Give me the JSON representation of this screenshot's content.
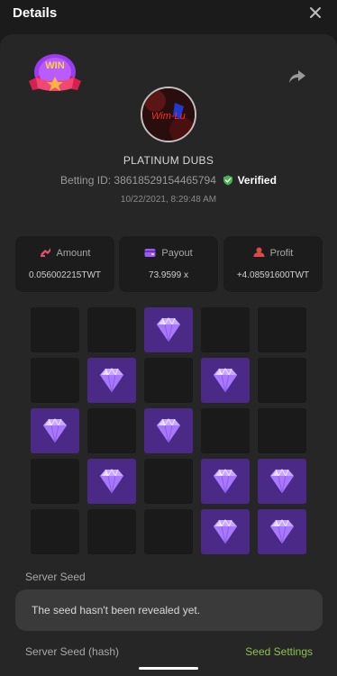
{
  "header": {
    "title": "Details",
    "close_icon": "close-icon"
  },
  "badge": {
    "text": "WIN",
    "icon": "win-ribbon-icon"
  },
  "share_icon": "share-arrow-icon",
  "player": {
    "avatar_text": "Wim-Lu",
    "name": "PLATINUM DUBS",
    "betting_id_label": "Betting ID:",
    "betting_id": "38618529154465794",
    "verified_label": "Verified",
    "date": "10/22/2021, 8:29:48 AM"
  },
  "stats": [
    {
      "label": "Amount",
      "value": "0.056002215TWT",
      "icon": "amount-icon",
      "color": "#e0506a"
    },
    {
      "label": "Payout",
      "value": "73.9599 x",
      "icon": "wallet-icon",
      "color": "#9b5cf0"
    },
    {
      "label": "Profit",
      "value": "+4.08591600TWT",
      "icon": "profit-icon",
      "color": "#e04848"
    }
  ],
  "grid": {
    "rows": 5,
    "cols": 5,
    "cells": [
      [
        0,
        0,
        1,
        0,
        0
      ],
      [
        0,
        1,
        0,
        1,
        0
      ],
      [
        1,
        0,
        1,
        0,
        0
      ],
      [
        0,
        1,
        0,
        1,
        1
      ],
      [
        0,
        0,
        0,
        1,
        1
      ]
    ],
    "gem_icon": "diamond-icon",
    "gem_color": "#4a2a86"
  },
  "seed": {
    "server_seed_label": "Server Seed",
    "server_seed_value": "The seed hasn't been revealed yet.",
    "hash_label": "Server Seed (hash)",
    "settings_label": "Seed Settings"
  },
  "colors": {
    "accent_green": "#8bc34a",
    "verified_green": "#4caf50",
    "background": "#1b1b1c",
    "sheet": "#262627"
  }
}
